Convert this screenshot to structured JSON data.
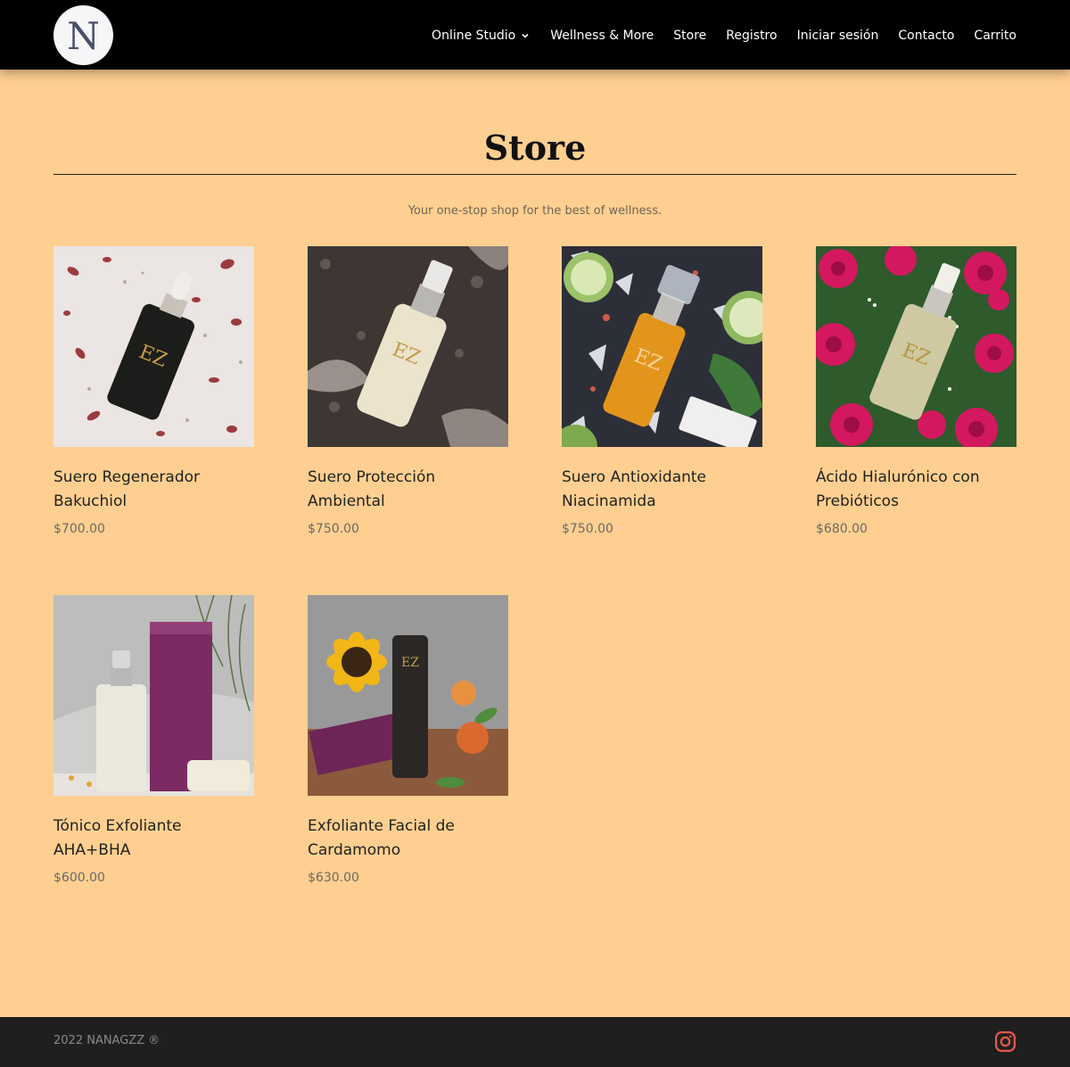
{
  "header": {
    "logo_letter": "N",
    "nav": [
      {
        "label": "Online Studio",
        "has_dropdown": true
      },
      {
        "label": "Wellness & More"
      },
      {
        "label": "Store"
      },
      {
        "label": "Registro"
      },
      {
        "label": "Iniciar sesión"
      },
      {
        "label": "Contacto"
      },
      {
        "label": "Carrito"
      }
    ]
  },
  "page": {
    "title": "Store",
    "subtitle": "Your one-stop shop for the best of wellness."
  },
  "products": [
    {
      "name": "Suero Regenerador Bakuchiol",
      "price": "$700.00"
    },
    {
      "name": "Suero Protección Ambiental",
      "price": "$750.00"
    },
    {
      "name": "Suero Antioxidante Niacinamida",
      "price": "$750.00"
    },
    {
      "name": "Ácido Hialurónico con Prebióticos",
      "price": "$680.00"
    },
    {
      "name": "Tónico Exfoliante AHA+BHA",
      "price": "$600.00"
    },
    {
      "name": "Exfoliante Facial de Cardamomo",
      "price": "$630.00"
    }
  ],
  "footer": {
    "copyright": "2022 NANAGZZ ®",
    "social_icon": "instagram-icon"
  },
  "colors": {
    "page_bg": "#fecf90",
    "header_bg": "#000000",
    "footer_bg": "#1f1f1f",
    "instagram": "#e2574c"
  }
}
